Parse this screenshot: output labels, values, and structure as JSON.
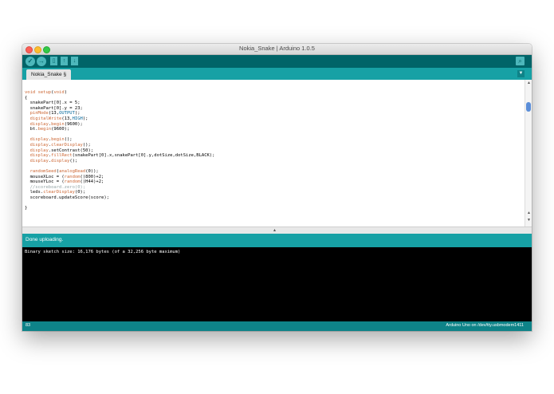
{
  "window": {
    "title": "Nokia_Snake | Arduino 1.0.5"
  },
  "toolbar": {
    "verify_icon": "checkmark-icon",
    "upload_icon": "arrow-right-icon",
    "new_icon": "new-file-icon",
    "open_icon": "open-arrow-icon",
    "save_icon": "save-arrow-icon",
    "serial_monitor_icon": "magnifier-icon"
  },
  "tabs": {
    "active": "Nokia_Snake §",
    "menu_icon": "triangle-down-icon"
  },
  "status": {
    "message": "Done uploading."
  },
  "console": {
    "output": "Binary sketch size: 16,176 bytes (of a 32,256 byte maximum)"
  },
  "footer": {
    "line": "83",
    "board": "Arduino Uno on /dev/tty.usbmodem1411"
  },
  "colors": {
    "toolbar": "#006468",
    "tabbar": "#17a1a5",
    "status": "#17a1a5",
    "footer": "#0e8388",
    "console_bg": "#000000",
    "keyword": "#cc6633",
    "constant": "#006699"
  }
}
